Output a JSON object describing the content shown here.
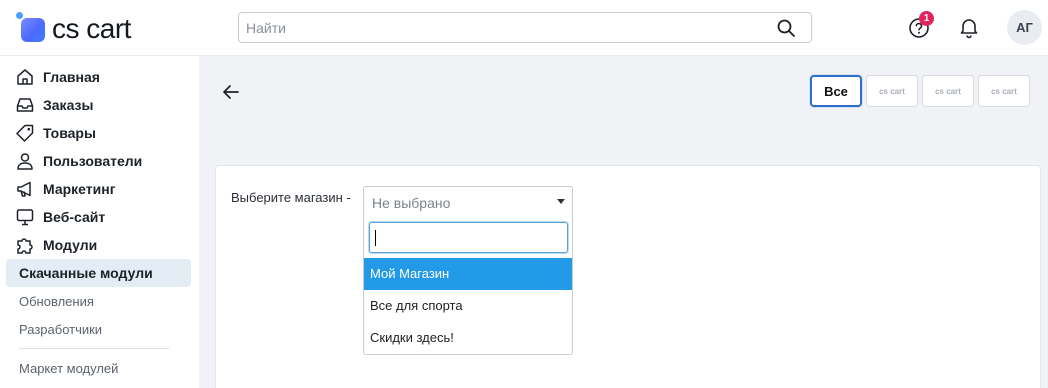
{
  "header": {
    "logo_text": "cs cart",
    "search_placeholder": "Найти",
    "help_badge": "1",
    "avatar_initials": "АГ"
  },
  "sidebar": {
    "items": [
      {
        "label": "Главная",
        "icon": "home-icon"
      },
      {
        "label": "Заказы",
        "icon": "inbox-icon"
      },
      {
        "label": "Товары",
        "icon": "tag-icon"
      },
      {
        "label": "Пользователи",
        "icon": "user-icon"
      },
      {
        "label": "Маркетинг",
        "icon": "megaphone-icon"
      },
      {
        "label": "Веб-сайт",
        "icon": "monitor-icon"
      },
      {
        "label": "Модули",
        "icon": "puzzle-icon"
      }
    ],
    "sub_active": "Скачанные модули",
    "sub_items": [
      "Обновления",
      "Разработчики"
    ],
    "marketplace": "Маркет модулей"
  },
  "main": {
    "storefronts": {
      "all_label": "Все",
      "thumb_labels": [
        "cs cart",
        "cs cart",
        "cs cart"
      ]
    },
    "form": {
      "label": "Выберите магазин -",
      "selected": "Не выбрано",
      "search_value": "",
      "options": [
        "Мой Магазин",
        "Все для спорта",
        "Скидки здесь!"
      ],
      "highlighted_index": 0
    }
  },
  "colors": {
    "accent": "#229ae8",
    "badge": "#e2235d",
    "active_nav": "#e4ecf6"
  }
}
